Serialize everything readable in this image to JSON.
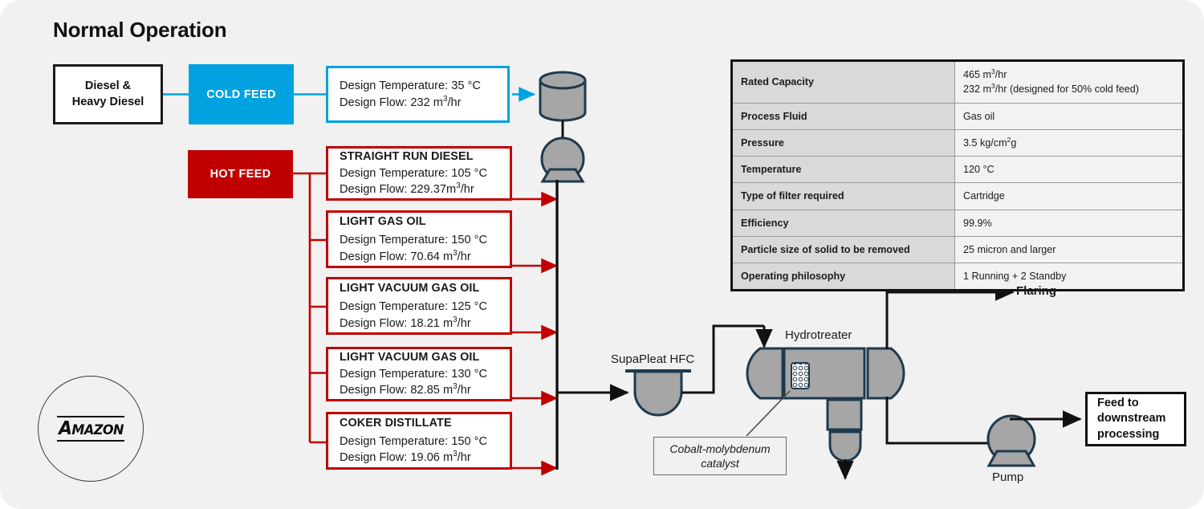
{
  "page": {
    "title": "Normal Operation",
    "background": "#f1f1f1"
  },
  "colors": {
    "cold": "#00a2e0",
    "hot": "#c00000",
    "equipment_fill": "#a6a6a6",
    "equipment_stroke": "#1f3a4d",
    "line": "#111111"
  },
  "source": {
    "label": "Diesel &\nHeavy Diesel",
    "line1": "Diesel &",
    "line2": "Heavy Diesel"
  },
  "feeds": {
    "cold": {
      "tag": "COLD FEED",
      "info": {
        "temperature": "Design Temperature: 35 °C",
        "flow_pre": "Design Flow: 232 m",
        "flow_sup": "3",
        "flow_post": "/hr"
      }
    },
    "hot": {
      "tag": "HOT FEED"
    }
  },
  "streams": [
    {
      "name": "STRAIGHT RUN DIESEL",
      "temperature": "Design Temperature: 105 °C",
      "flow_pre": "Design Flow: 229.37m",
      "flow_sup": "3",
      "flow_post": "/hr"
    },
    {
      "name": "LIGHT GAS OIL",
      "temperature": "Design Temperature: 150 °C",
      "flow_pre": "Design Flow: 70.64 m",
      "flow_sup": "3",
      "flow_post": "/hr"
    },
    {
      "name": "LIGHT VACUUM GAS OIL",
      "temperature": "Design Temperature: 125 °C",
      "flow_pre": "Design Flow: 18.21 m",
      "flow_sup": "3",
      "flow_post": "/hr"
    },
    {
      "name": "LIGHT VACUUM GAS OIL",
      "temperature": "Design Temperature: 130 °C",
      "flow_pre": "Design Flow: 82.85 m",
      "flow_sup": "3",
      "flow_post": "/hr"
    },
    {
      "name": "COKER DISTILLATE",
      "temperature": "Design Temperature: 150 °C",
      "flow_pre": "Design Flow: 19.06 m",
      "flow_sup": "3",
      "flow_post": "/hr"
    }
  ],
  "spec_table": {
    "rows": [
      {
        "key": "Rated Capacity",
        "value_lines": [
          {
            "pre": "465 m",
            "sup": "3",
            "post": "/hr"
          },
          {
            "pre": "232 m",
            "sup": "3",
            "post": "/hr (designed for 50% cold feed)"
          }
        ]
      },
      {
        "key": "Process Fluid",
        "value_lines": [
          {
            "pre": "Gas oil",
            "sup": "",
            "post": ""
          }
        ]
      },
      {
        "key": "Pressure",
        "value_lines": [
          {
            "pre": "3.5 kg/cm",
            "sup": "2",
            "post": "g"
          }
        ]
      },
      {
        "key": "Temperature",
        "value_lines": [
          {
            "pre": "120 °C",
            "sup": "",
            "post": ""
          }
        ]
      },
      {
        "key": "Type of filter required",
        "value_lines": [
          {
            "pre": "Cartridge",
            "sup": "",
            "post": ""
          }
        ]
      },
      {
        "key": "Efficiency",
        "value_lines": [
          {
            "pre": "99.9%",
            "sup": "",
            "post": ""
          }
        ]
      },
      {
        "key": "Particle size of solid to be removed",
        "value_lines": [
          {
            "pre": "25 micron and larger",
            "sup": "",
            "post": ""
          }
        ]
      },
      {
        "key": "Operating philosophy",
        "value_lines": [
          {
            "pre": " 1 Running + 2 Standby",
            "sup": "",
            "post": ""
          }
        ]
      }
    ]
  },
  "schematic": {
    "supapleat_label": "SupaPleat HFC",
    "hydrotreater_label": "Hydrotreater",
    "flaring_label": "Flaring",
    "pump_label": "Pump",
    "catalyst_note_line1": "Cobalt-molybdenum",
    "catalyst_note_line2": "catalyst",
    "downstream_line1": "Feed to",
    "downstream_line2": "downstream",
    "downstream_line3": "processing"
  },
  "logo": {
    "first_letter": "A",
    "rest": "MAZON"
  }
}
